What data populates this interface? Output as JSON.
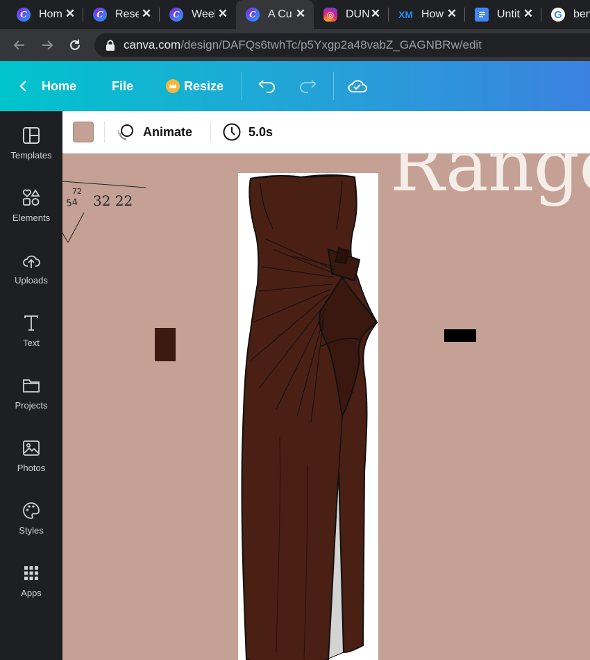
{
  "browser": {
    "tabs": [
      {
        "title": "Home",
        "favicon": "canva-icon"
      },
      {
        "title": "Research",
        "favicon": "canva-icon"
      },
      {
        "title": "Week",
        "favicon": "canva-icon"
      },
      {
        "title": "A Cu",
        "favicon": "canva-icon",
        "active": true
      },
      {
        "title": "DUN",
        "favicon": "instagram-icon"
      },
      {
        "title": "How",
        "favicon": "xm-icon",
        "favicon_text": "XM"
      },
      {
        "title": "Untitled",
        "favicon": "docs-icon"
      },
      {
        "title": "bene",
        "favicon": "google-icon",
        "favicon_text": "G"
      }
    ],
    "url_host": "canva.com",
    "url_path": "/design/DAFQs6twhTc/p5Yxgp2a48vabZ_GAGNBRw/edit"
  },
  "header": {
    "home_label": "Home",
    "file_label": "File",
    "resize_label": "Resize"
  },
  "sidebar": {
    "items": [
      {
        "label": "Templates",
        "icon": "templates-icon"
      },
      {
        "label": "Elements",
        "icon": "elements-icon"
      },
      {
        "label": "Uploads",
        "icon": "upload-cloud-icon"
      },
      {
        "label": "Text",
        "icon": "text-icon"
      },
      {
        "label": "Projects",
        "icon": "folder-icon"
      },
      {
        "label": "Photos",
        "icon": "image-icon"
      },
      {
        "label": "Styles",
        "icon": "palette-icon"
      },
      {
        "label": "Apps",
        "icon": "apps-grid-icon"
      }
    ]
  },
  "toolbar": {
    "color_swatch": "#c4a194",
    "animate_label": "Animate",
    "duration_label": "5.0s"
  },
  "canvas": {
    "background_color": "#c4a194",
    "headline_text": "Range",
    "handwritten_notes": "72 54 32 22",
    "dress_color": "#4a1f14"
  }
}
